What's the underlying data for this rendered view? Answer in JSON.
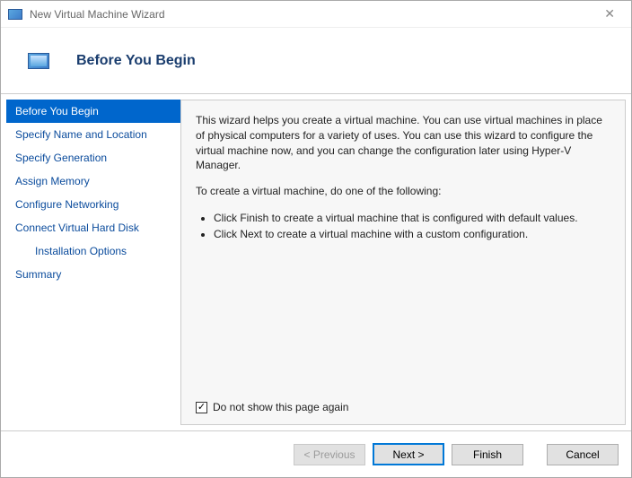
{
  "window": {
    "title": "New Virtual Machine Wizard"
  },
  "header": {
    "heading": "Before You Begin"
  },
  "sidebar": {
    "steps": [
      {
        "label": "Before You Begin"
      },
      {
        "label": "Specify Name and Location"
      },
      {
        "label": "Specify Generation"
      },
      {
        "label": "Assign Memory"
      },
      {
        "label": "Configure Networking"
      },
      {
        "label": "Connect Virtual Hard Disk"
      },
      {
        "label": "Installation Options"
      },
      {
        "label": "Summary"
      }
    ]
  },
  "content": {
    "intro": "This wizard helps you create a virtual machine. You can use virtual machines in place of physical computers for a variety of uses. You can use this wizard to configure the virtual machine now, and you can change the configuration later using Hyper-V Manager.",
    "instruction": "To create a virtual machine, do one of the following:",
    "bullets": [
      "Click Finish to create a virtual machine that is configured with default values.",
      "Click Next to create a virtual machine with a custom configuration."
    ],
    "checkbox_label": "Do not show this page again",
    "checkbox_checked": true
  },
  "footer": {
    "previous": "< Previous",
    "next": "Next >",
    "finish": "Finish",
    "cancel": "Cancel"
  }
}
